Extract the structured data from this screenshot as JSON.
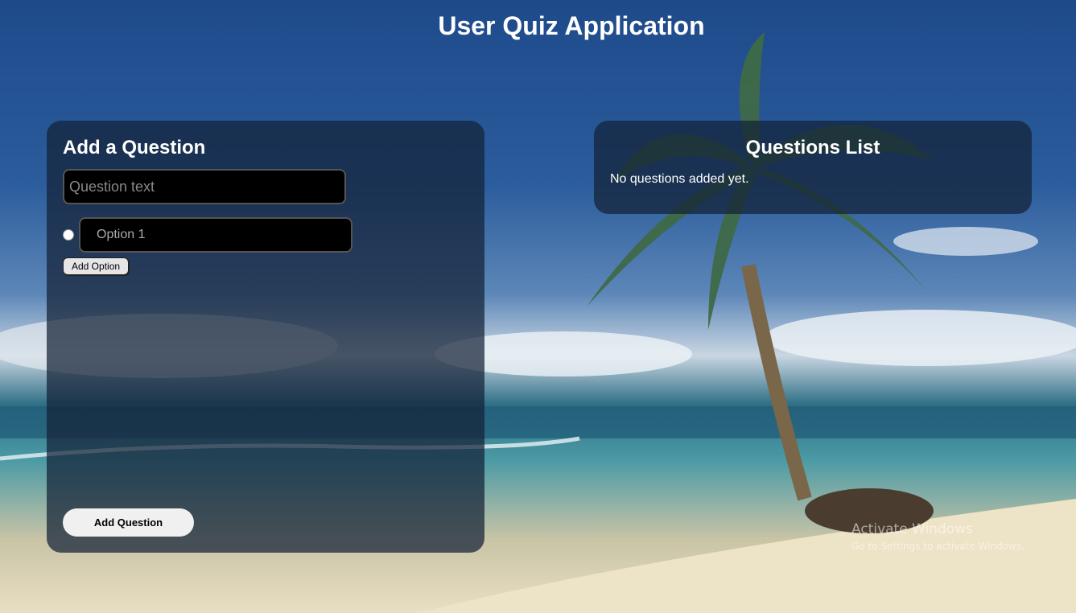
{
  "app": {
    "title": "User Quiz Application"
  },
  "add_panel": {
    "heading": "Add a Question",
    "question_placeholder": "Question text",
    "option_placeholder": "Option 1",
    "add_option_label": "Add Option",
    "add_question_label": "Add Question"
  },
  "list_panel": {
    "heading": "Questions List",
    "empty_text": "No questions added yet."
  },
  "watermark": {
    "title": "Activate Windows",
    "subtitle": "Go to Settings to activate Windows."
  }
}
